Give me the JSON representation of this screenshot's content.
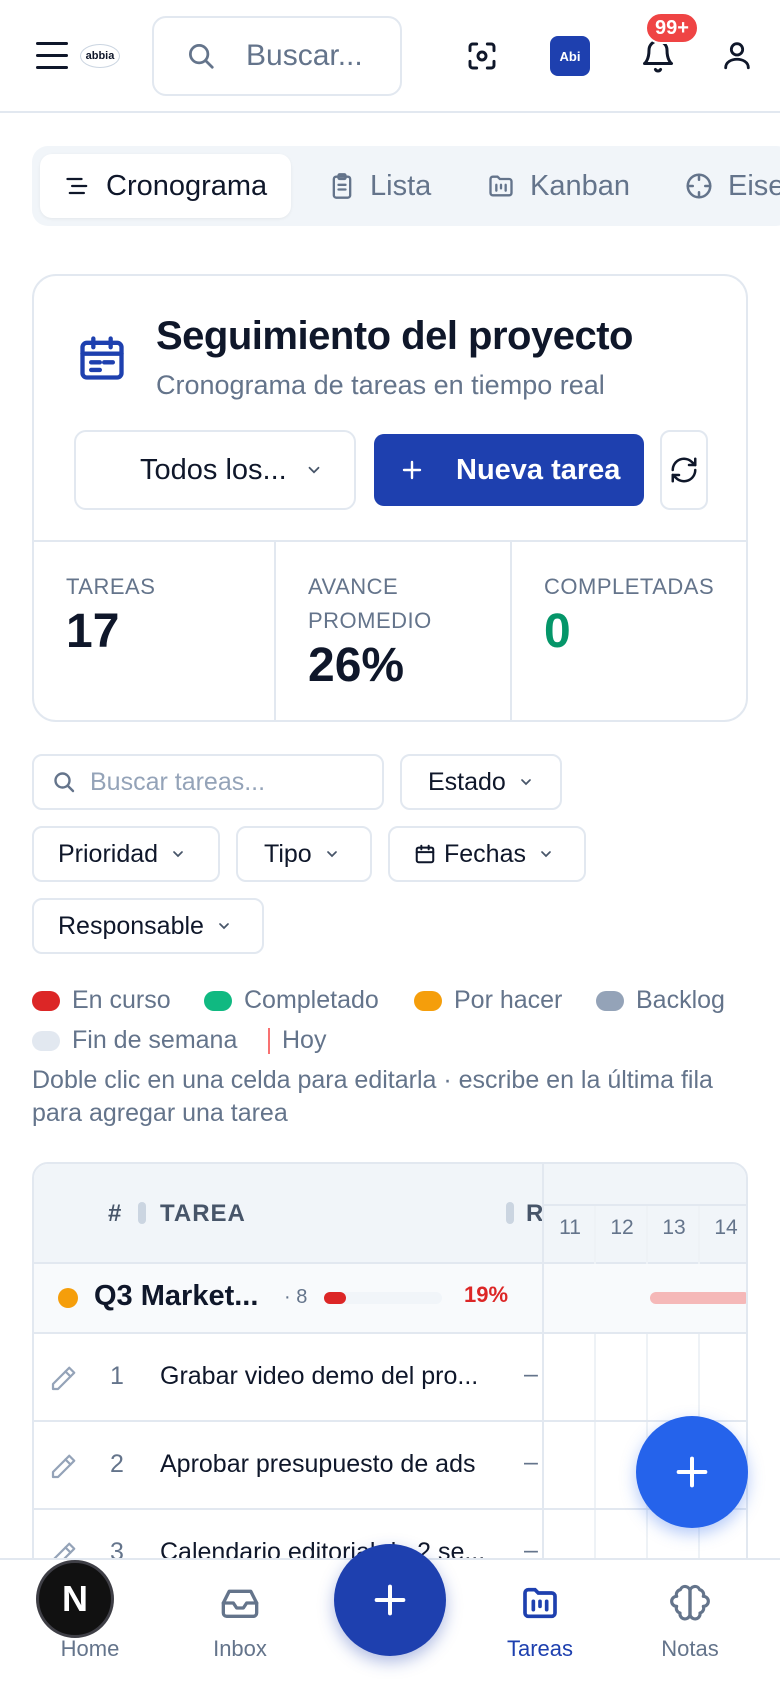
{
  "header": {
    "logo_text": "abbia",
    "search_placeholder": "Buscar...",
    "assistant_badge": "Abi",
    "notifications_count": "99+"
  },
  "tabs": [
    {
      "label": "Cronograma",
      "icon": "timeline-icon",
      "active": true
    },
    {
      "label": "Lista",
      "icon": "clipboard-icon",
      "active": false
    },
    {
      "label": "Kanban",
      "icon": "kanban-icon",
      "active": false
    },
    {
      "label": "Eise",
      "icon": "crosshair-icon",
      "active": false
    }
  ],
  "project": {
    "title": "Seguimiento del proyecto",
    "subtitle": "Cronograma de tareas en tiempo real",
    "filter_select": "Todos los...",
    "new_task_label": "Nueva tarea",
    "stats": [
      {
        "label": "TAREAS",
        "value": "17"
      },
      {
        "label": "AVANCE PROMEDIO",
        "value": "26%"
      },
      {
        "label": "COMPLETADAS",
        "value": "0"
      }
    ]
  },
  "filters": {
    "search_placeholder": "Buscar tareas...",
    "estado": "Estado",
    "prioridad": "Prioridad",
    "tipo": "Tipo",
    "fechas": "Fechas",
    "responsable": "Responsable"
  },
  "legend": {
    "items": [
      {
        "label": "En curso",
        "color": "#dc2626"
      },
      {
        "label": "Completado",
        "color": "#10b981"
      },
      {
        "label": "Por hacer",
        "color": "#f59e0b"
      },
      {
        "label": "Backlog",
        "color": "#94a3b8"
      },
      {
        "label": "Fin de semana",
        "color": "#e2e8f0"
      },
      {
        "label": "Hoy",
        "color": "#f87171"
      }
    ],
    "hint": "Doble clic en una celda para editarla · escribe en la última fila para agregar una tarea"
  },
  "gantt": {
    "col_num": "#",
    "col_task": "TAREA",
    "col_r": "R",
    "days": [
      "11",
      "12",
      "13",
      "14"
    ],
    "group": {
      "name": "Q3 Market...",
      "count": "· 8",
      "progress": 0.19,
      "progress_label": "19%",
      "color": "#f59e0b"
    },
    "rows": [
      {
        "num": "1",
        "name": "Grabar video demo del pro...",
        "r": "–"
      },
      {
        "num": "2",
        "name": "Aprobar presupuesto de ads",
        "r": "–"
      },
      {
        "num": "3",
        "name": "Calendario editorial de 2 se...",
        "r": "–"
      }
    ]
  },
  "bottom_nav": {
    "items": [
      {
        "label": "Home",
        "icon": "home-icon",
        "active": false
      },
      {
        "label": "Inbox",
        "icon": "inbox-icon",
        "active": false
      },
      {
        "label": "Tareas",
        "icon": "tasks-folder-icon",
        "active": true
      },
      {
        "label": "Notas",
        "icon": "brain-icon",
        "active": false
      }
    ],
    "dev_badge": "N"
  },
  "colors": {
    "primary": "#1e40af",
    "fab": "#2563eb",
    "danger": "#dc2626",
    "success": "#059669"
  }
}
